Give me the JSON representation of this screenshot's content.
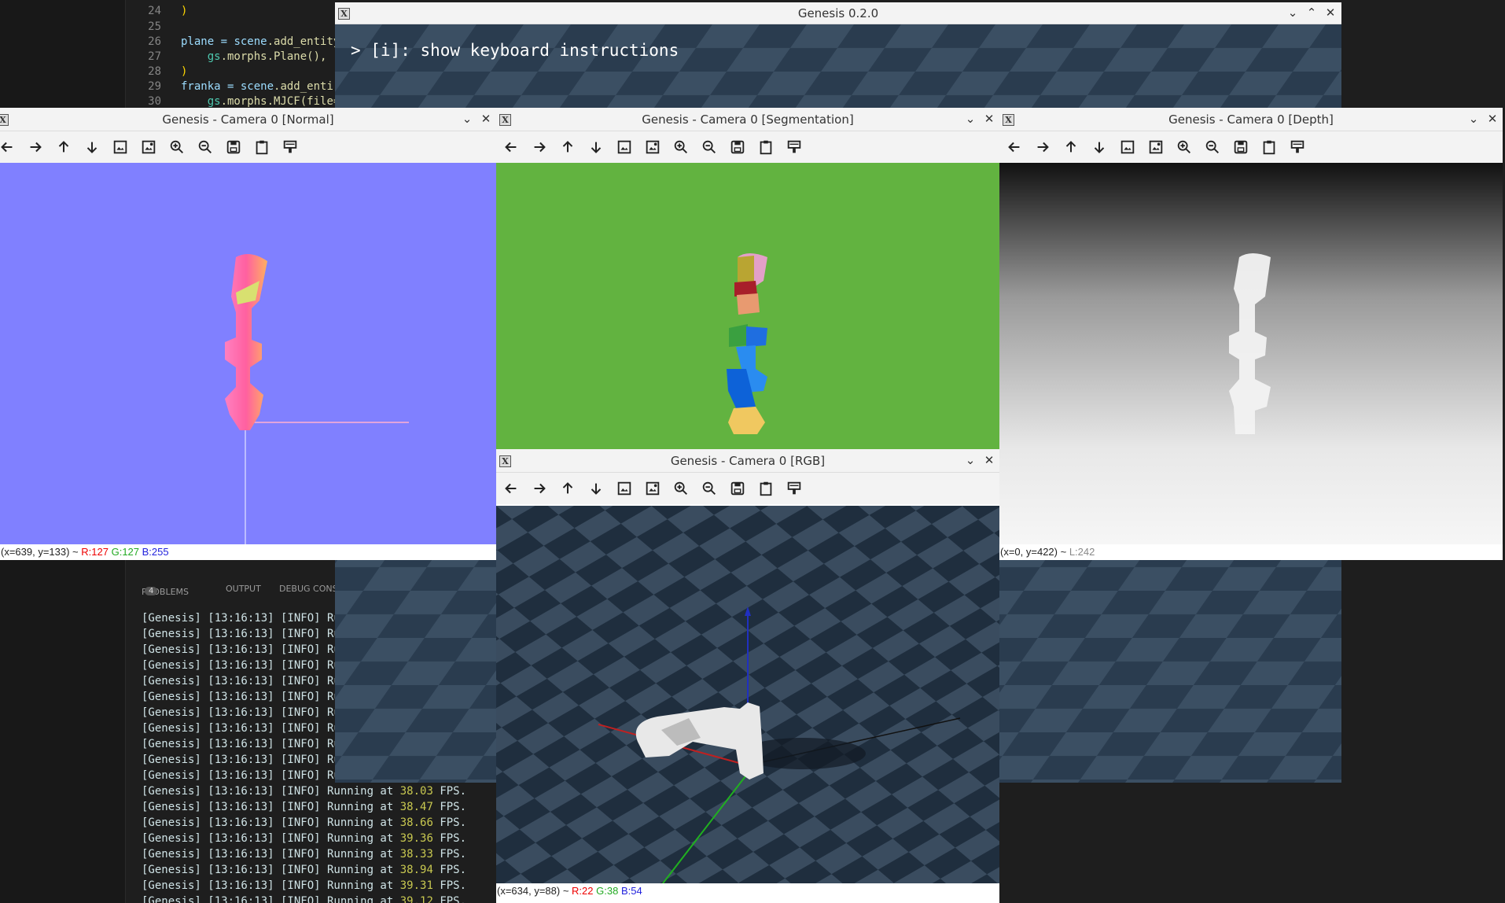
{
  "editor": {
    "lines": [
      {
        "num": "24",
        "text": ")"
      },
      {
        "num": "25",
        "text": ""
      },
      {
        "num": "26",
        "pre": "plane = ",
        "obj": "scene",
        "fn": ".add_entity"
      },
      {
        "num": "27",
        "pre": "    ",
        "obj": "gs",
        "fn": ".morphs.Plane(),"
      },
      {
        "num": "28",
        "text": ")"
      },
      {
        "num": "29",
        "pre": "franka = ",
        "obj": "scene",
        "fn": ".add_enti"
      },
      {
        "num": "30",
        "pre": "    ",
        "obj": "gs",
        "fn": ".morphs.MJCF(file="
      }
    ]
  },
  "panel": {
    "tabs": [
      "PROBLEMS",
      "OUTPUT",
      "DEBUG CONS"
    ],
    "problems_count": "4",
    "log_short": [
      "[Genesis] [13:16:13] [INFO] Run",
      "[Genesis] [13:16:13] [INFO] Run",
      "[Genesis] [13:16:13] [INFO] Run",
      "[Genesis] [13:16:13] [INFO] Run",
      "[Genesis] [13:16:13] [INFO] Run",
      "[Genesis] [13:16:13] [INFO] Run",
      "[Genesis] [13:16:13] [INFO] Run",
      "[Genesis] [13:16:13] [INFO] Run",
      "[Genesis] [13:16:13] [INFO] Run",
      "[Genesis] [13:16:13] [INFO] Run",
      "[Genesis] [13:16:13] [INFO] Run"
    ],
    "log_prefix": "[Genesis] [13:16:13] [INFO] Running at ",
    "log_suffix": " FPS.",
    "fps_values": [
      "38.03",
      "38.47",
      "38.66",
      "39.36",
      "38.33",
      "38.94",
      "39.31",
      "39.12"
    ]
  },
  "viewer": {
    "title": "Genesis 0.2.0",
    "hint": "> [i]: show keyboard instructions"
  },
  "cam_normal": {
    "title": "Genesis - Camera 0 [Normal]",
    "status_pos": "(x=639, y=133) ~ ",
    "r": "R:127",
    "g": "G:127",
    "b": "B:255"
  },
  "cam_seg": {
    "title": "Genesis - Camera 0 [Segmentation]"
  },
  "cam_depth": {
    "title": "Genesis - Camera 0 [Depth]",
    "status_pos": "(x=0, y=422) ~ ",
    "l": "L:242"
  },
  "cam_rgb": {
    "title": "Genesis - Camera 0 [RGB]",
    "status_pos": "(x=634, y=88) ~ ",
    "r": "R:22",
    "g": "G:38",
    "b": "B:54"
  },
  "colors": {
    "normal_bg": "#8080ff",
    "seg_bg": "#62b340",
    "floor_dark": "#1f2f3f",
    "floor_light": "#3a4d60"
  },
  "toolbar_icons": [
    "back-arrow-icon",
    "forward-arrow-icon",
    "up-arrow-icon",
    "down-arrow-icon",
    "image-icon",
    "image-edit-icon",
    "zoom-in-icon",
    "zoom-out-icon",
    "save-icon",
    "clipboard-icon",
    "settings-icon"
  ]
}
